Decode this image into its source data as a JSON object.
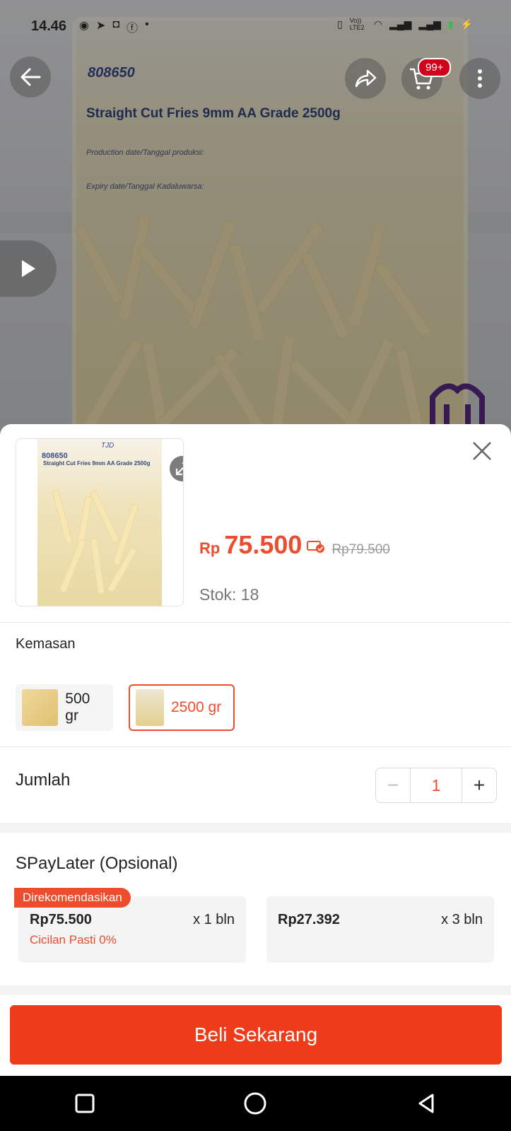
{
  "status_bar": {
    "time": "14.46",
    "network_label": "Vo)) LTE2"
  },
  "background": {
    "product_code": "808650",
    "product_name": "Straight Cut Fries 9mm AA Grade 2500g",
    "production_date_label": "Production date/Tanggal produksi:",
    "expiry_date_label": "Expiry date/Tanggal Kadaluwarsa:",
    "cart_badge": "99+"
  },
  "sheet": {
    "thumbnail": {
      "code": "808650",
      "name": "Straight Cut Fries 9mm AA Grade 2500g",
      "brand": "TJD"
    },
    "price_currency": "Rp",
    "price": "75.500",
    "original_price": "Rp79.500",
    "stock": "Stok: 18",
    "variant_section_label": "Kemasan",
    "variants": [
      {
        "label": "500 gr",
        "selected": false
      },
      {
        "label": "2500 gr",
        "selected": true
      }
    ],
    "quantity_label": "Jumlah",
    "quantity_value": "1",
    "quantity_minus": "−",
    "quantity_plus": "+",
    "paylater_title": "SPayLater (Opsional)",
    "recommended_badge": "Direkomendasikan",
    "plans": [
      {
        "amount": "Rp75.500",
        "tenor": "x 1 bln",
        "note": "Cicilan Pasti 0%"
      },
      {
        "amount": "Rp27.392",
        "tenor": "x 3 bln",
        "note": ""
      }
    ],
    "buy_button": "Beli Sekarang"
  },
  "colors": {
    "accent": "#ee4d2d",
    "button": "#ee3c1a"
  }
}
